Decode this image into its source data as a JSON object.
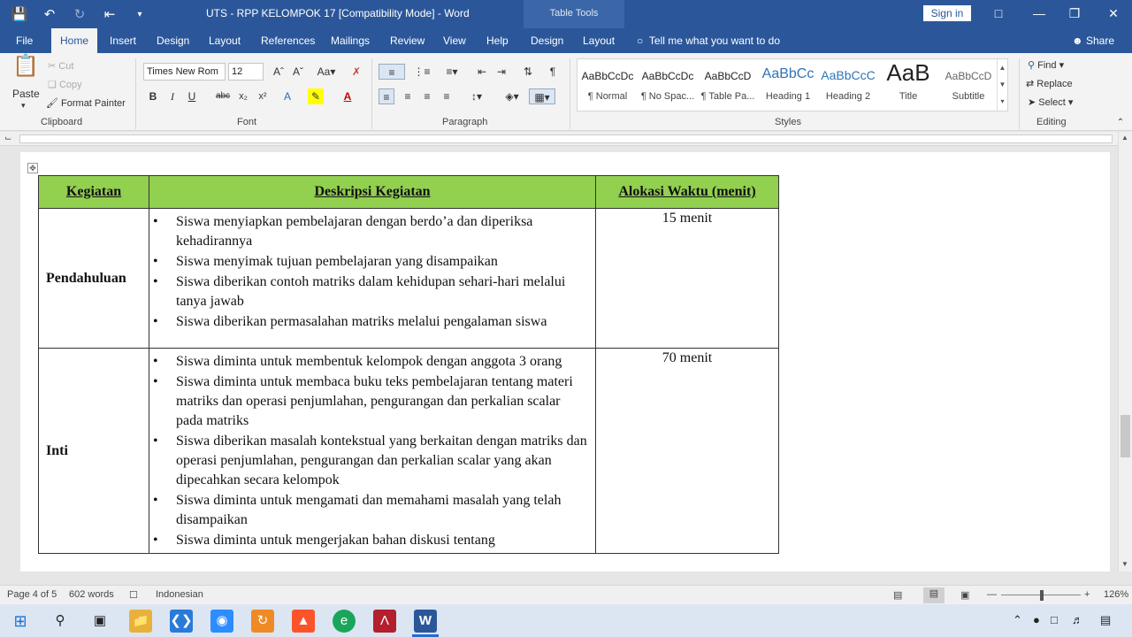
{
  "titlebar": {
    "doc_title": "UTS - RPP KELOMPOK 17 [Compatibility Mode]  -  Word",
    "context_tab": "Table Tools",
    "signin": "Sign in",
    "icons": {
      "save": "save-icon",
      "undo": "undo-icon",
      "redo": "redo-icon",
      "touch": "touch-mode-icon",
      "more": "customize-qat-icon"
    }
  },
  "menu": {
    "tabs": [
      "File",
      "Home",
      "Insert",
      "Design",
      "Layout",
      "References",
      "Mailings",
      "Review",
      "View",
      "Help",
      "Design",
      "Layout"
    ],
    "active": "Home",
    "tellme": "Tell me what you want to do",
    "share": "Share"
  },
  "ribbon": {
    "clipboard": {
      "label": "Clipboard",
      "paste": "Paste",
      "cut": "Cut",
      "copy": "Copy",
      "format_painter": "Format Painter"
    },
    "font": {
      "label": "Font",
      "family": "Times New Rom",
      "size": "12"
    },
    "paragraph": {
      "label": "Paragraph"
    },
    "styles": {
      "label": "Styles",
      "items": [
        {
          "sample": "AaBbCcDc",
          "name": "¶ Normal"
        },
        {
          "sample": "AaBbCcDc",
          "name": "¶ No Spac..."
        },
        {
          "sample": "AaBbCcD",
          "name": "¶ Table Pa..."
        },
        {
          "sample": "AaBbCc",
          "name": "Heading 1"
        },
        {
          "sample": "AaBbCcC",
          "name": "Heading 2"
        },
        {
          "sample": "AaB",
          "name": "Title"
        },
        {
          "sample": "AaBbCcD",
          "name": "Subtitle"
        }
      ]
    },
    "editing": {
      "label": "Editing",
      "find": "Find",
      "replace": "Replace",
      "select": "Select"
    }
  },
  "document": {
    "headers": [
      "Kegiatan",
      "Deskripsi Kegiatan",
      "Alokasi Waktu (menit)"
    ],
    "rows": [
      {
        "label": "Pendahuluan",
        "time": "15 menit",
        "items": [
          "Siswa menyiapkan pembelajaran dengan berdo’a dan diperiksa kehadirannya",
          "Siswa menyimak tujuan pembelajaran yang disampaikan",
          "Siswa diberikan contoh matriks dalam kehidupan sehari-hari melalui tanya jawab",
          "Siswa diberikan permasalahan matriks melalui pengalaman siswa"
        ]
      },
      {
        "label": "Inti",
        "time": "70 menit",
        "items": [
          "Siswa diminta untuk membentuk kelompok dengan anggota 3 orang",
          "Siswa diminta untuk membaca buku teks pembelajaran tentang materi matriks dan operasi penjumlahan, pengurangan dan perkalian scalar pada matriks",
          "Siswa diberikan masalah kontekstual yang berkaitan dengan matriks dan operasi penjumlahan, pengurangan dan perkalian scalar yang akan dipecahkan secara kelompok",
          "Siswa diminta untuk mengamati dan memahami masalah yang telah disampaikan",
          "Siswa diminta untuk mengerjakan bahan diskusi tentang"
        ]
      }
    ]
  },
  "statusbar": {
    "page": "Page 4 of 5",
    "words": "602 words",
    "language": "Indonesian",
    "zoom": "126%"
  },
  "colors": {
    "word_blue": "#2b579a",
    "table_header": "#92d050"
  }
}
